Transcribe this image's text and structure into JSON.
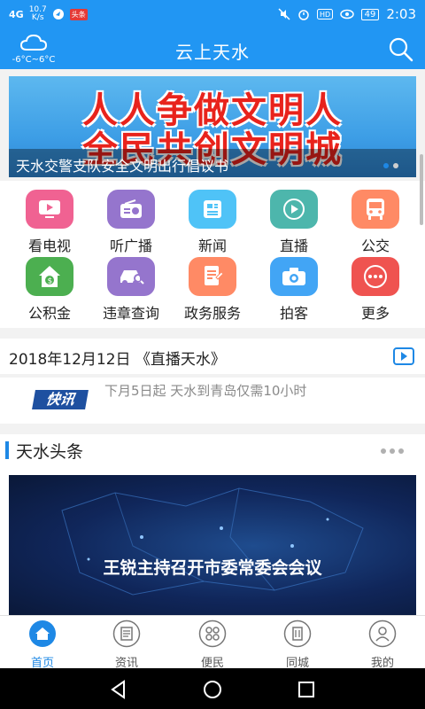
{
  "status": {
    "signal": "4G",
    "speed_value": "10.7",
    "speed_unit": "K/s",
    "red_badge": "头条",
    "battery": "49",
    "time": "2:03"
  },
  "appbar": {
    "weather_temp": "-6°C~6°C",
    "title": "云上天水"
  },
  "banner": {
    "line1": "人人争做文明人",
    "line2": "全民共创文明城",
    "caption": "天水交警支队安全文明出行倡议书"
  },
  "services": [
    {
      "label": "看电视",
      "icon": "tv-icon",
      "color": "#f06292"
    },
    {
      "label": "听广播",
      "icon": "radio-icon",
      "color": "#9575cd"
    },
    {
      "label": "新闻",
      "icon": "news-icon",
      "color": "#4fc3f7"
    },
    {
      "label": "直播",
      "icon": "live-icon",
      "color": "#4db6ac"
    },
    {
      "label": "公交",
      "icon": "bus-icon",
      "color": "#ff8a65"
    },
    {
      "label": "公积金",
      "icon": "fund-icon",
      "color": "#4caf50"
    },
    {
      "label": "违章查询",
      "icon": "car-icon",
      "color": "#9575cd"
    },
    {
      "label": "政务服务",
      "icon": "document-icon",
      "color": "#ff8a65"
    },
    {
      "label": "拍客",
      "icon": "camera-icon",
      "color": "#42a5f5"
    },
    {
      "label": "更多",
      "icon": "more-icon",
      "color": "#ef5350"
    }
  ],
  "dateline": {
    "text": "2018年12月12日 《直播天水》"
  },
  "newsflash": {
    "logo": "快讯",
    "text": "下月5日起 天水到青岛仅需10小时"
  },
  "section": {
    "title": "天水头条",
    "headline": "王锐主持召开市委常委会会议"
  },
  "tabs": [
    {
      "label": "首页",
      "icon": "home-icon",
      "active": true
    },
    {
      "label": "资讯",
      "icon": "newspaper-icon",
      "active": false
    },
    {
      "label": "便民",
      "icon": "grid-icon",
      "active": false
    },
    {
      "label": "同城",
      "icon": "building-icon",
      "active": false
    },
    {
      "label": "我的",
      "icon": "user-icon",
      "active": false
    }
  ],
  "colors": {
    "primary": "#2196f3",
    "accent": "#1e88e5"
  }
}
